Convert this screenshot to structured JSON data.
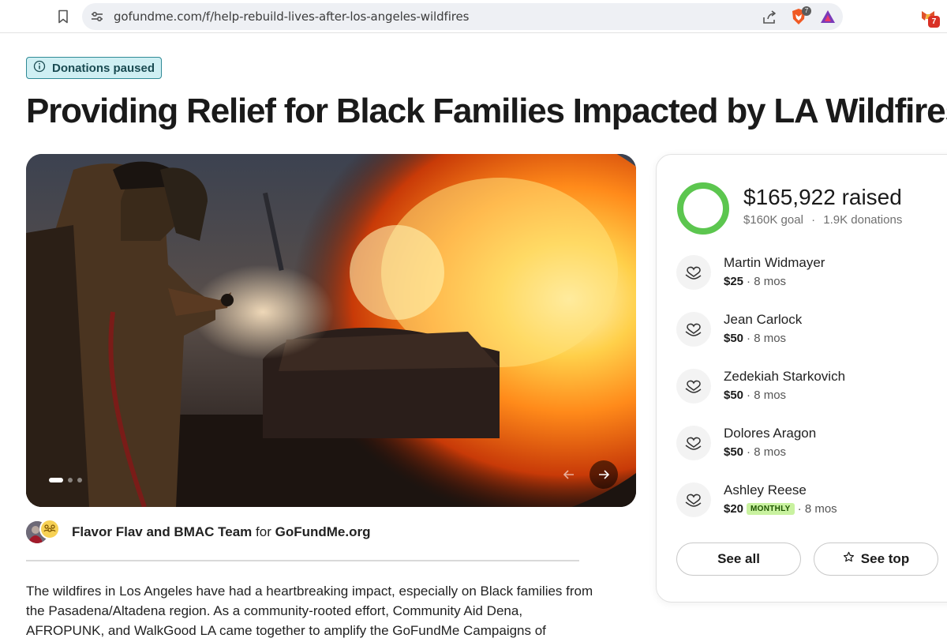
{
  "browser": {
    "url": "gofundme.com/f/help-rebuild-lives-after-los-angeles-wildfires",
    "brave_badge": "7",
    "extension_badge": "7"
  },
  "campaign": {
    "status_badge": "Donations paused",
    "title": "Providing Relief for Black Families Impacted by LA Wildfires",
    "organizer": "Flavor Flav and BMAC Team",
    "organizer_connector": "for",
    "beneficiary": "GoFundMe.org",
    "story": "The wildfires in Los Angeles have had a heartbreaking impact, especially on Black families from the Pasadena/Altadena region. As a community-rooted effort, Community Aid Dena, AFROPUNK, and WalkGood LA came together to amplify the GoFundMe Campaigns of",
    "carousel": {
      "total_slides": 3,
      "active_slide": 1
    }
  },
  "progress": {
    "raised": "$165,922 raised",
    "goal": "$160K goal",
    "separator": "·",
    "donations": "1.9K donations",
    "fraction": 1.0,
    "ring_color": "#5cc64f"
  },
  "donors": [
    {
      "name": "Martin Widmayer",
      "amount": "$25",
      "time": "· 8 mos",
      "monthly": ""
    },
    {
      "name": "Jean Carlock",
      "amount": "$50",
      "time": "· 8 mos",
      "monthly": ""
    },
    {
      "name": "Zedekiah Starkovich",
      "amount": "$50",
      "time": "· 8 mos",
      "monthly": ""
    },
    {
      "name": "Dolores Aragon",
      "amount": "$50",
      "time": "· 8 mos",
      "monthly": ""
    },
    {
      "name": "Ashley Reese",
      "amount": "$20",
      "time": "· 8 mos",
      "monthly": "MONTHLY"
    }
  ],
  "buttons": {
    "see_all": "See all",
    "see_top": "See top"
  },
  "icons": {
    "bookmark": "bookmark-icon",
    "site_info": "site-info-icon",
    "share": "share-icon",
    "brave_shield": "brave-shield-icon",
    "brave_rewards": "brave-rewards-icon",
    "extension": "extension-icon",
    "info": "info-icon",
    "donor": "heart-hand-icon",
    "star": "star-icon",
    "prev": "arrow-left-icon",
    "next": "arrow-right-icon"
  },
  "colors": {
    "badge_bg": "#cfeff3",
    "badge_border": "#2f8a96",
    "progress_green": "#5cc64f",
    "monthly_bg": "#c9f2a0"
  }
}
